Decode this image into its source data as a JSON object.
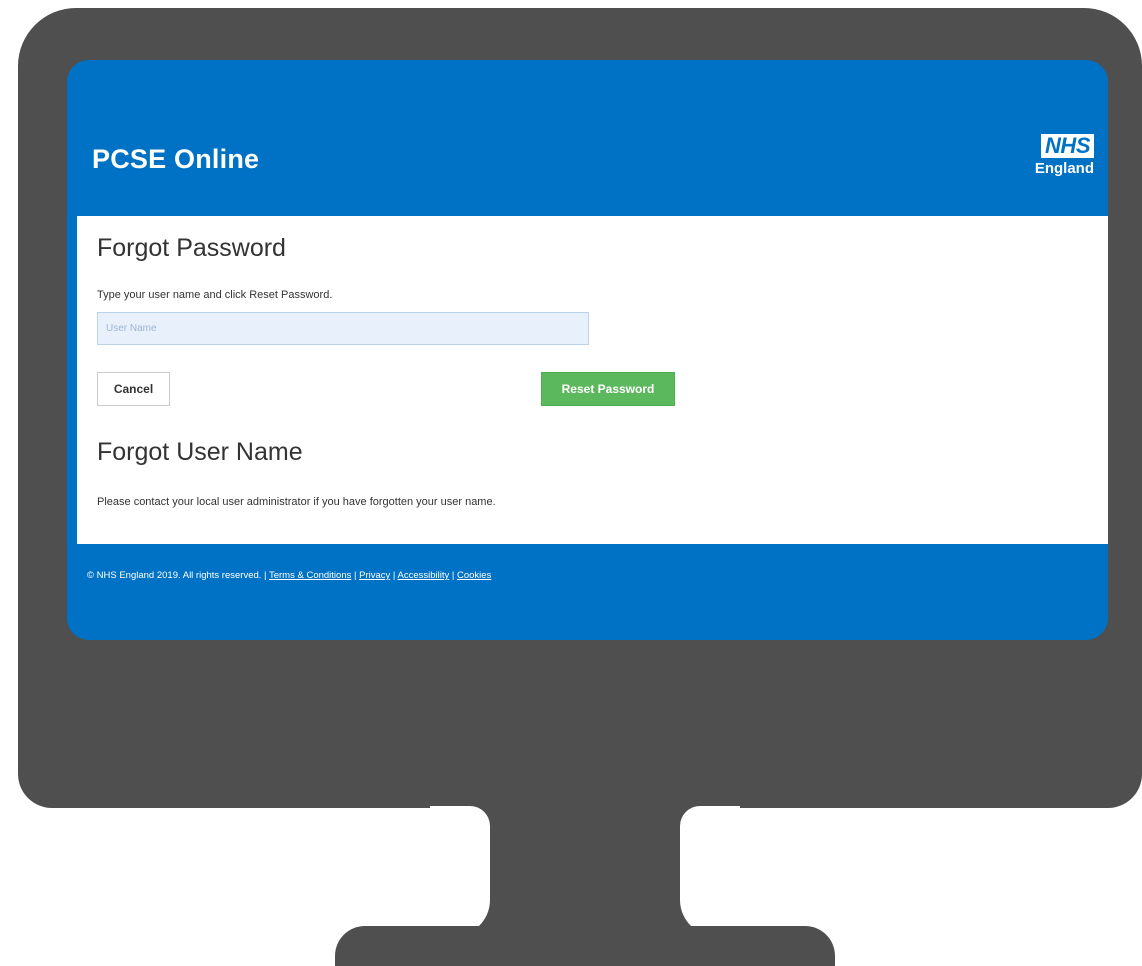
{
  "header": {
    "app_title": "PCSE Online",
    "logo_mark": "NHS",
    "logo_sub": "England"
  },
  "forgot_password": {
    "heading": "Forgot Password",
    "instructions": "Type your user name and click Reset Password.",
    "username_value": "",
    "username_placeholder": "User Name",
    "cancel_label": "Cancel",
    "reset_label": "Reset Password"
  },
  "forgot_username": {
    "heading": "Forgot User Name",
    "instructions": "Please contact your local user administrator if you have forgotten your user name."
  },
  "footer": {
    "copyright": "© NHS England 2019. All rights reserved.",
    "separator": "|",
    "links": [
      "Terms & Conditions",
      "Privacy",
      "Accessibility",
      "Cookies"
    ]
  },
  "colors": {
    "nhs_blue": "#0072c6",
    "success_green": "#5cb85c",
    "monitor_gray": "#4f4f4f",
    "input_background": "#e8f0fb"
  },
  "icons": {
    "monitor": "desktop-monitor-icon"
  }
}
